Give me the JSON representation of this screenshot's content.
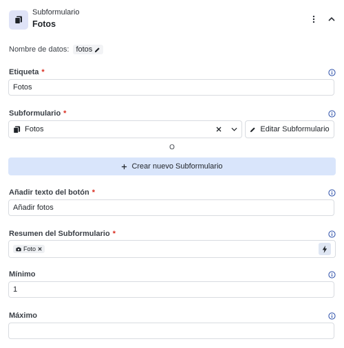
{
  "header": {
    "subtitle": "Subformulario",
    "title": "Fotos"
  },
  "data_name": {
    "label": "Nombre de datos:",
    "value": "fotos"
  },
  "fields": {
    "etiqueta": {
      "label": "Etiqueta",
      "value": "Fotos"
    },
    "subformulario": {
      "label": "Subformulario",
      "value": "Fotos",
      "edit_button": "Editar Subformulario",
      "or_text": "O",
      "create_button": "Crear nuevo Subformulario"
    },
    "button_text": {
      "label": "Añadir texto del botón",
      "value": "Añadir fotos"
    },
    "resumen": {
      "label": "Resumen del Subformulario",
      "tag": "Foto"
    },
    "minimo": {
      "label": "Mínimo",
      "value": "1"
    },
    "maximo": {
      "label": "Máximo",
      "value": ""
    }
  },
  "colors": {
    "accent_bg": "#d9e5fb",
    "required": "#d92d20",
    "icon_bg": "#dfe3f7"
  }
}
